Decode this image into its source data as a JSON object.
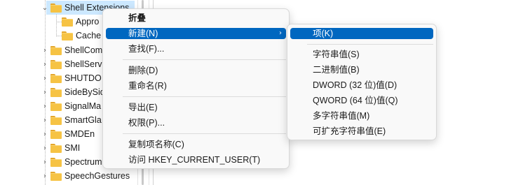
{
  "tree": {
    "items": [
      {
        "label": "Shell Extensions"
      },
      {
        "label": "Appro"
      },
      {
        "label": "Cache"
      },
      {
        "label": "ShellCom"
      },
      {
        "label": "ShellServ"
      },
      {
        "label": "SHUTDO"
      },
      {
        "label": "SideBySid"
      },
      {
        "label": "SignalMa"
      },
      {
        "label": "SmartGla"
      },
      {
        "label": "SMDEn"
      },
      {
        "label": "SMI"
      },
      {
        "label": "Spectrum"
      },
      {
        "label": "SpeechGestures"
      }
    ],
    "expanded_glyph": "⌄",
    "collapsed_glyph": "›"
  },
  "context_menu": {
    "items": [
      {
        "label": "折叠"
      },
      {
        "label": "新建(N)"
      },
      {
        "label": "查找(F)..."
      },
      {
        "label": "删除(D)"
      },
      {
        "label": "重命名(R)"
      },
      {
        "label": "导出(E)"
      },
      {
        "label": "权限(P)..."
      },
      {
        "label": "复制项名称(C)"
      },
      {
        "label": "访问 HKEY_CURRENT_USER(T)"
      }
    ],
    "submenu_arrow": "›"
  },
  "submenu": {
    "items": [
      {
        "label": "项(K)"
      },
      {
        "label": "字符串值(S)"
      },
      {
        "label": "二进制值(B)"
      },
      {
        "label": "DWORD (32 位)值(D)"
      },
      {
        "label": "QWORD (64 位)值(Q)"
      },
      {
        "label": "多字符串值(M)"
      },
      {
        "label": "可扩充字符串值(E)"
      }
    ]
  },
  "colors": {
    "highlight": "#0067c0",
    "tree_selection": "#cce8ff",
    "folder": "#f6c344"
  }
}
